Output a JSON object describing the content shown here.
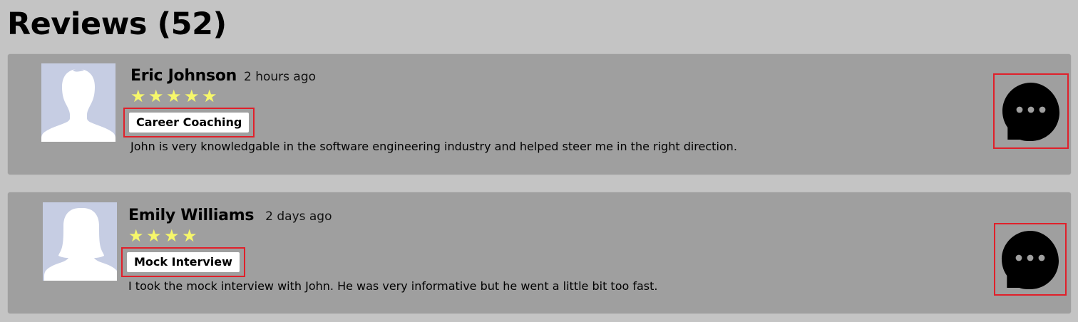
{
  "page": {
    "title": "Reviews (52)"
  },
  "reviews": [
    {
      "name": "Eric Johnson",
      "time": "2 hours ago",
      "rating": 5,
      "stars": "★★★★★",
      "tag": "Career Coaching",
      "text": "John is very knowledgable in the software engineering industry and helped steer me in the right direction.",
      "avatar_icon": "male-silhouette-icon",
      "action_icon": "chat-bubble-more-icon"
    },
    {
      "name": "Emily Williams",
      "time": "2 days ago",
      "rating": 4,
      "stars": "★★★★",
      "tag": "Mock Interview",
      "text": "I took the mock interview with John. He was very informative but he went a little bit too fast.",
      "avatar_icon": "female-silhouette-icon",
      "action_icon": "chat-bubble-more-icon"
    }
  ],
  "colors": {
    "page_background": "#c4c4c4",
    "card_background": "#9f9f9f",
    "avatar_background": "#c6cde3",
    "star": "#f6f76a",
    "highlight_border": "#e0202a",
    "tag_background": "#ffffff"
  }
}
